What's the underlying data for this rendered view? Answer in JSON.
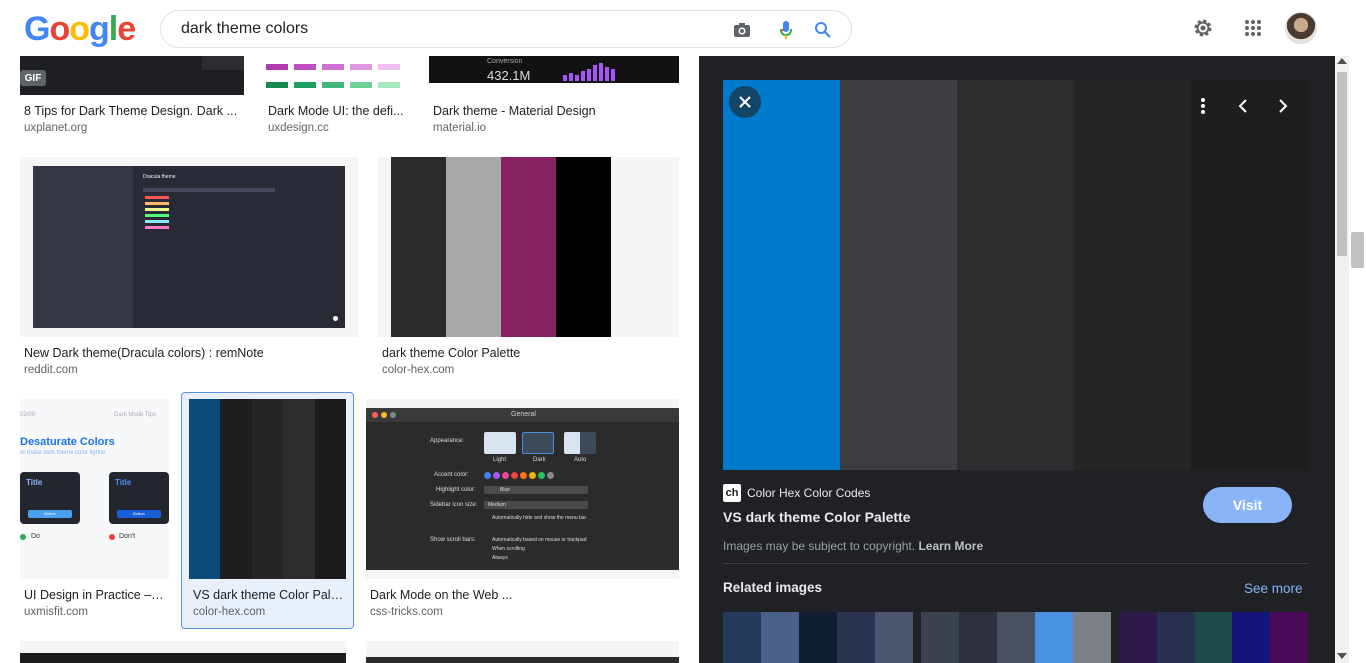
{
  "header": {
    "logo_letters": [
      "G",
      "o",
      "o",
      "g",
      "l",
      "e"
    ],
    "search_query": "dark theme colors",
    "icons": [
      "camera-icon",
      "mic-icon",
      "search-icon",
      "gear-icon",
      "apps-grid-icon",
      "avatar"
    ]
  },
  "results": [
    {
      "title": "8 Tips for Dark Theme Design. Dark ...",
      "site": "uxplanet.org",
      "badge": "GIF"
    },
    {
      "title": "Dark Mode UI: the defi...",
      "site": "uxdesign.cc"
    },
    {
      "title": "Dark theme - Material Design",
      "site": "material.io",
      "thumb_text_1": "Conversion",
      "thumb_text_2": "432.1M"
    },
    {
      "title": "New Dark theme(Dracula colors) : remNote",
      "site": "reddit.com",
      "thumb_text": "Dracula theme"
    },
    {
      "title": "dark theme Color Palette",
      "site": "color-hex.com"
    },
    {
      "title": "UI Design in Practice – ...",
      "site": "uxmisfit.com",
      "thumb_heading": "Desaturate Colors",
      "thumb_sub": "or make dark theme color lighter",
      "thumb_card_title": "Title",
      "thumb_button": "Button",
      "thumb_do": "Do",
      "thumb_dont": "Don't",
      "thumb_corner": "Dark Mode Tips",
      "thumb_num": "02/09"
    },
    {
      "title": "VS dark theme Color Pale...",
      "site": "color-hex.com",
      "selected": true
    },
    {
      "title": "Dark Mode on the Web ...",
      "site": "css-tricks.com",
      "thumb_window_title": "General",
      "thumb_appearance": "Appearance:",
      "thumb_modes": [
        "Light",
        "Dark",
        "Auto"
      ],
      "thumb_accent": "Accent color:",
      "thumb_highlight": "Highlight color:",
      "thumb_highlight_val": "Blue",
      "thumb_sidebar": "Sidebar icon size:",
      "thumb_sidebar_val": "Medium",
      "thumb_autohide": "Automatically hide and show the menu bar",
      "thumb_scroll": "Show scroll bars:",
      "thumb_scroll_opts": [
        "Automatically based on mouse or trackpad",
        "When scrolling",
        "Always"
      ]
    }
  ],
  "palettes": {
    "dark_theme": [
      "#2b2b2b",
      "#a9a9a9",
      "#862262",
      "#000000"
    ],
    "vs_dark": [
      "#0c4a7a",
      "#1e1e1e",
      "#252526",
      "#2d2d30",
      "#1b1b1c"
    ]
  },
  "panel": {
    "palette_colors": [
      "#007acc",
      "#3e3e42",
      "#2d2d30",
      "#252526",
      "#1e1e1e"
    ],
    "source_logo": "ch",
    "source_name": "Color Hex Color Codes",
    "title": "VS dark theme Color Palette",
    "visit_label": "Visit",
    "copyright": "Images may be subject to copyright.",
    "learn_more": "Learn More",
    "related_title": "Related images",
    "see_more": "See more",
    "related": [
      [
        "#233a5a",
        "#4a628a",
        "#0f1e33",
        "#2c3350",
        "#4d5570"
      ],
      [
        "#3c4250",
        "#2e3240",
        "#4a5060",
        "#4a90e2",
        "#7a7f88"
      ],
      [
        "#2e1a4a",
        "#2a3050",
        "#1f4a4a",
        "#14147a",
        "#4a0a5a"
      ]
    ]
  }
}
